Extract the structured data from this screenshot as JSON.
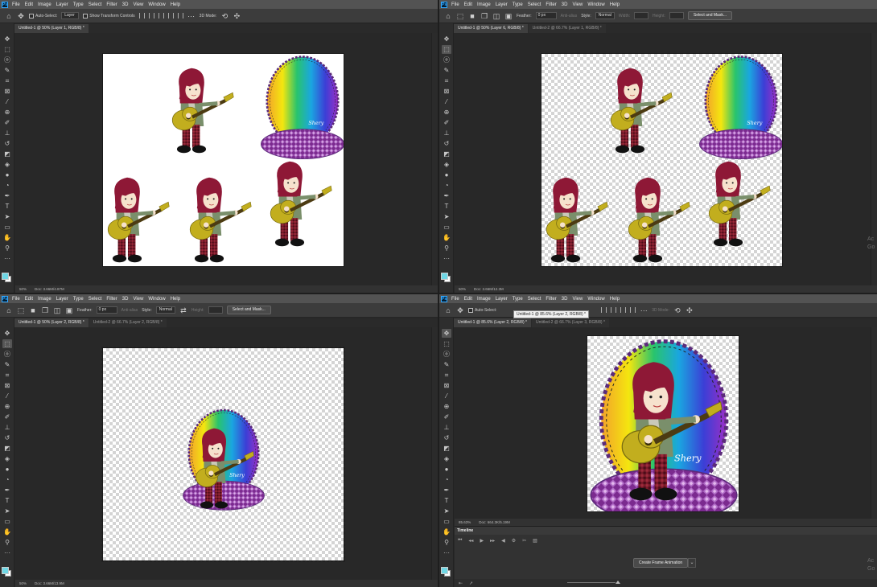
{
  "menus": [
    "File",
    "Edit",
    "Image",
    "Layer",
    "Type",
    "Select",
    "Filter",
    "3D",
    "View",
    "Window",
    "Help"
  ],
  "ps_logo": "Ps",
  "options_move": {
    "auto_select": "Auto-Select:",
    "auto_select_target": "Layer",
    "show_transform": "Show Transform Controls",
    "mode_3d": "3D Mode:"
  },
  "options_marquee": {
    "feather_label": "Feather:",
    "feather_value": "0 px",
    "anti_alias": "Anti-alias",
    "style_label": "Style:",
    "style_value": "Normal",
    "width_label": "Width:",
    "height_label": "Height:",
    "select_mask": "Select and Mask..."
  },
  "quadrants": [
    {
      "tabs": [
        "Untitled-1 @ 50% (Layer 1, RGB/8) *"
      ],
      "zoom": "50%",
      "doc": "Doc: 3.66M/4.87M"
    },
    {
      "tabs": [
        "Untitled-1 @ 50% (Layer 6, RGB/8) *",
        "Untitled-2 @ 66.7% (Layer 1, RGB/8) *"
      ],
      "zoom": "50%",
      "doc": "Doc: 3.66M/12.3M"
    },
    {
      "tabs": [
        "Untitled-1 @ 50% (Layer 2, RGB/8) *",
        "Untitled-2 @ 66.7% (Layer 2, RGB/8) *"
      ],
      "zoom": "50%",
      "doc": "Doc: 3.66M/13.9M"
    },
    {
      "tabs": [
        "Untitled-1 @ 85.6% (Layer 2, RGB/8) *",
        "Untitled-2 @ 66.7% (Layer 3, RGB/8) *"
      ],
      "zoom": "85.63%",
      "doc": "Doc: 664.3K/5.19M",
      "tooltip": "Untitled-1 @ 85.6% (Layer 2, RGB/8) *"
    }
  ],
  "activate_text": "Ac",
  "activate_text2": "Go",
  "timeline": {
    "title": "Timeline",
    "create_button": "Create Frame Animation"
  },
  "colors": {
    "foreground": "#6fd7e5",
    "background": "#ffffff",
    "ui_dark": "#282828",
    "accent": "#31a8ff"
  },
  "icons": [
    "home-icon",
    "move-icon",
    "marquee-icon",
    "lasso-icon",
    "quick-select-icon",
    "crop-icon",
    "frame-icon",
    "eyedropper-icon",
    "healing-icon",
    "brush-icon",
    "stamp-icon",
    "history-brush-icon",
    "eraser-icon",
    "bucket-icon",
    "blur-icon",
    "dodge-icon",
    "pen-icon",
    "type-icon",
    "path-select-icon",
    "shape-icon",
    "hand-icon",
    "zoom-icon",
    "more-icon"
  ]
}
